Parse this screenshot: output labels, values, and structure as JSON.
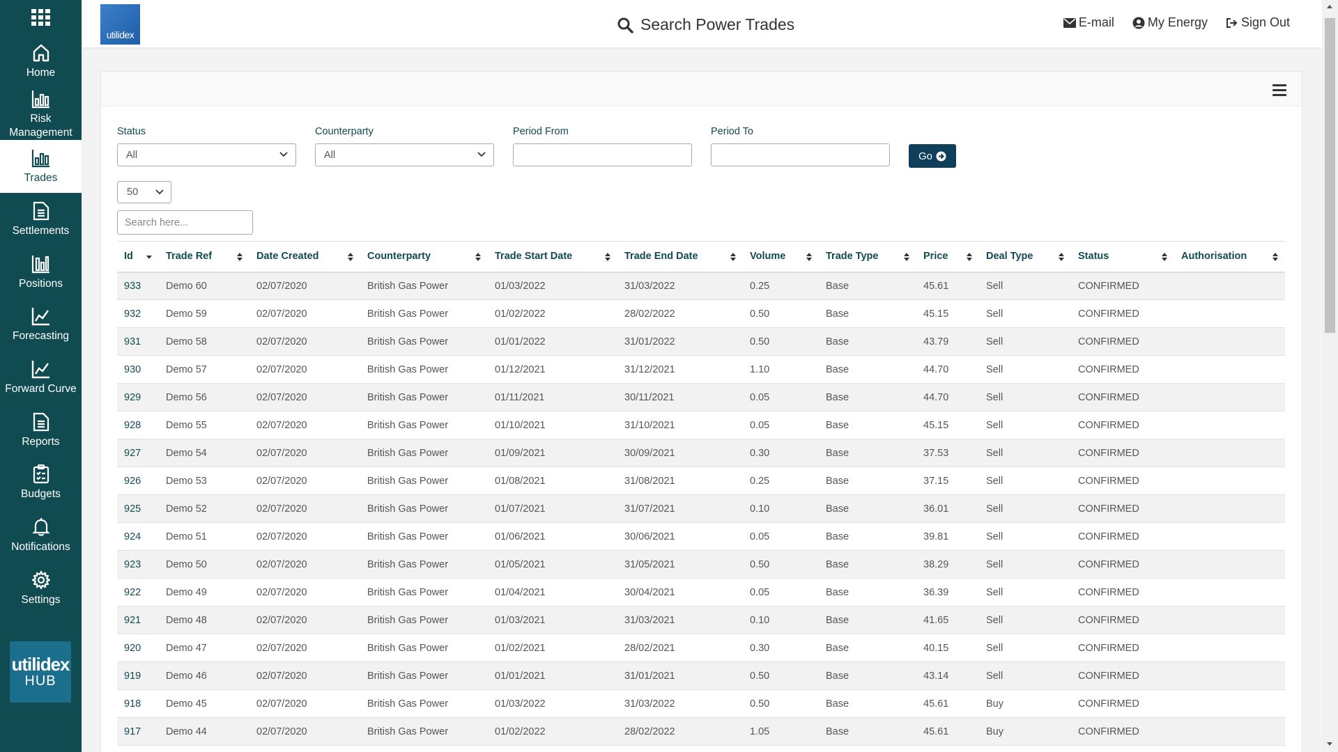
{
  "sidebar": {
    "items": [
      {
        "label": "Home",
        "icon": "home-icon"
      },
      {
        "label": "Risk\nManagement",
        "line1": "Risk",
        "line2": "Management",
        "icon": "bar-chart-icon"
      },
      {
        "label": "Trades",
        "icon": "bar-chart-icon"
      },
      {
        "label": "Settlements",
        "icon": "document-icon"
      },
      {
        "label": "Positions",
        "icon": "column-chart-icon"
      },
      {
        "label": "Forecasting",
        "icon": "line-chart-icon"
      },
      {
        "label": "Forward Curve",
        "icon": "line-chart-icon"
      },
      {
        "label": "Reports",
        "icon": "document-icon"
      },
      {
        "label": "Budgets",
        "icon": "clipboard-icon"
      },
      {
        "label": "Notifications",
        "icon": "bell-icon"
      },
      {
        "label": "Settings",
        "icon": "gear-icon"
      }
    ],
    "hub_logo_word": "utilidex",
    "hub_logo_sub": "HUB"
  },
  "header": {
    "brand": "utilidex",
    "title": "Search Power Trades",
    "links": [
      "E-mail",
      "My Energy",
      "Sign Out"
    ]
  },
  "filters": {
    "status_label": "Status",
    "status_value": "All",
    "counterparty_label": "Counterparty",
    "counterparty_value": "All",
    "period_from_label": "Period From",
    "period_from_value": "",
    "period_to_label": "Period To",
    "period_to_value": "",
    "go_label": "Go",
    "page_size": "50",
    "search_placeholder": "Search here..."
  },
  "table": {
    "columns": [
      "Id",
      "Trade Ref",
      "Date Created",
      "Counterparty",
      "Trade Start Date",
      "Trade End Date",
      "Volume",
      "Trade Type",
      "Price",
      "Deal Type",
      "Status",
      "Authorisation"
    ],
    "rows": [
      [
        "933",
        "Demo 60",
        "02/07/2020",
        "British Gas Power",
        "01/03/2022",
        "31/03/2022",
        "0.25",
        "Base",
        "45.61",
        "Sell",
        "CONFIRMED",
        ""
      ],
      [
        "932",
        "Demo 59",
        "02/07/2020",
        "British Gas Power",
        "01/02/2022",
        "28/02/2022",
        "0.50",
        "Base",
        "45.15",
        "Sell",
        "CONFIRMED",
        ""
      ],
      [
        "931",
        "Demo 58",
        "02/07/2020",
        "British Gas Power",
        "01/01/2022",
        "31/01/2022",
        "0.50",
        "Base",
        "43.79",
        "Sell",
        "CONFIRMED",
        ""
      ],
      [
        "930",
        "Demo 57",
        "02/07/2020",
        "British Gas Power",
        "01/12/2021",
        "31/12/2021",
        "1.10",
        "Base",
        "44.70",
        "Sell",
        "CONFIRMED",
        ""
      ],
      [
        "929",
        "Demo 56",
        "02/07/2020",
        "British Gas Power",
        "01/11/2021",
        "30/11/2021",
        "0.05",
        "Base",
        "44.70",
        "Sell",
        "CONFIRMED",
        ""
      ],
      [
        "928",
        "Demo 55",
        "02/07/2020",
        "British Gas Power",
        "01/10/2021",
        "31/10/2021",
        "0.05",
        "Base",
        "45.15",
        "Sell",
        "CONFIRMED",
        ""
      ],
      [
        "927",
        "Demo 54",
        "02/07/2020",
        "British Gas Power",
        "01/09/2021",
        "30/09/2021",
        "0.30",
        "Base",
        "37.53",
        "Sell",
        "CONFIRMED",
        ""
      ],
      [
        "926",
        "Demo 53",
        "02/07/2020",
        "British Gas Power",
        "01/08/2021",
        "31/08/2021",
        "0.25",
        "Base",
        "37.15",
        "Sell",
        "CONFIRMED",
        ""
      ],
      [
        "925",
        "Demo 52",
        "02/07/2020",
        "British Gas Power",
        "01/07/2021",
        "31/07/2021",
        "0.10",
        "Base",
        "36.01",
        "Sell",
        "CONFIRMED",
        ""
      ],
      [
        "924",
        "Demo 51",
        "02/07/2020",
        "British Gas Power",
        "01/06/2021",
        "30/06/2021",
        "0.05",
        "Base",
        "39.81",
        "Sell",
        "CONFIRMED",
        ""
      ],
      [
        "923",
        "Demo 50",
        "02/07/2020",
        "British Gas Power",
        "01/05/2021",
        "31/05/2021",
        "0.50",
        "Base",
        "38.29",
        "Sell",
        "CONFIRMED",
        ""
      ],
      [
        "922",
        "Demo 49",
        "02/07/2020",
        "British Gas Power",
        "01/04/2021",
        "30/04/2021",
        "0.05",
        "Base",
        "36.39",
        "Sell",
        "CONFIRMED",
        ""
      ],
      [
        "921",
        "Demo 48",
        "02/07/2020",
        "British Gas Power",
        "01/03/2021",
        "31/03/2021",
        "0.10",
        "Base",
        "41.65",
        "Sell",
        "CONFIRMED",
        ""
      ],
      [
        "920",
        "Demo 47",
        "02/07/2020",
        "British Gas Power",
        "01/02/2021",
        "28/02/2021",
        "0.30",
        "Base",
        "40.15",
        "Sell",
        "CONFIRMED",
        ""
      ],
      [
        "919",
        "Demo 46",
        "02/07/2020",
        "British Gas Power",
        "01/01/2021",
        "31/01/2021",
        "0.50",
        "Base",
        "43.14",
        "Sell",
        "CONFIRMED",
        ""
      ],
      [
        "918",
        "Demo 45",
        "02/07/2020",
        "British Gas Power",
        "01/03/2022",
        "31/03/2022",
        "0.50",
        "Base",
        "45.61",
        "Buy",
        "CONFIRMED",
        ""
      ],
      [
        "917",
        "Demo 44",
        "02/07/2020",
        "British Gas Power",
        "01/02/2022",
        "28/02/2022",
        "1.05",
        "Base",
        "45.61",
        "Buy",
        "CONFIRMED",
        ""
      ]
    ]
  },
  "colors": {
    "sidebar_bg": "#114b52",
    "accent": "#114b52",
    "go_button": "#0f3f5a"
  }
}
